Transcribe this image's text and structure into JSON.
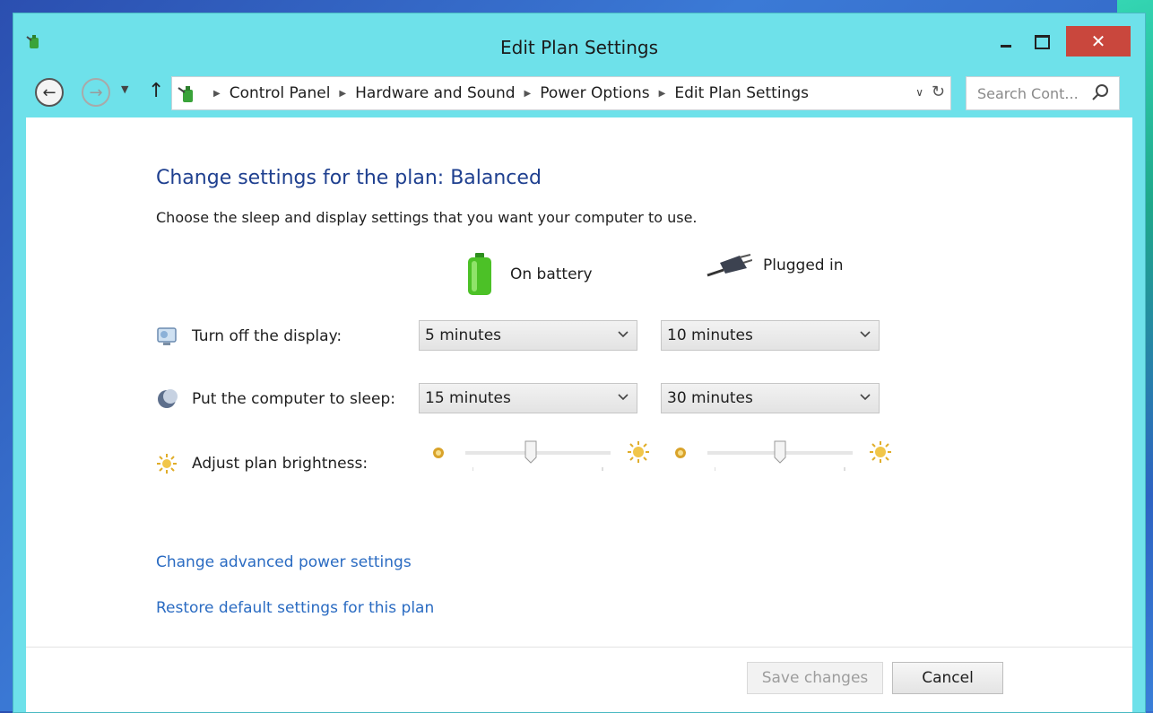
{
  "window": {
    "title": "Edit Plan Settings",
    "close_glyph": "✕"
  },
  "nav": {
    "breadcrumbs": [
      "Control Panel",
      "Hardware and Sound",
      "Power Options",
      "Edit Plan Settings"
    ],
    "search_placeholder": "Search Cont..."
  },
  "main": {
    "heading": "Change settings for the plan: Balanced",
    "subtitle": "Choose the sleep and display settings that you want your computer to use.",
    "columns": {
      "battery": "On battery",
      "plugged": "Plugged in"
    },
    "rows": [
      {
        "label": "Turn off the display:",
        "battery": "5 minutes",
        "plugged": "10 minutes"
      },
      {
        "label": "Put the computer to sleep:",
        "battery": "15 minutes",
        "plugged": "30 minutes"
      },
      {
        "label": "Adjust plan brightness:"
      }
    ],
    "brightness": {
      "battery_level_pct": 45,
      "plugged_level_pct": 50
    },
    "links": [
      "Change advanced power settings",
      "Restore default settings for this plan"
    ]
  },
  "buttons": {
    "save": "Save changes",
    "cancel": "Cancel"
  },
  "colors": {
    "heading": "#1e3f8f",
    "link": "#2a6bc2",
    "titlebar": "#6ee1ea",
    "close": "#c9473d"
  }
}
